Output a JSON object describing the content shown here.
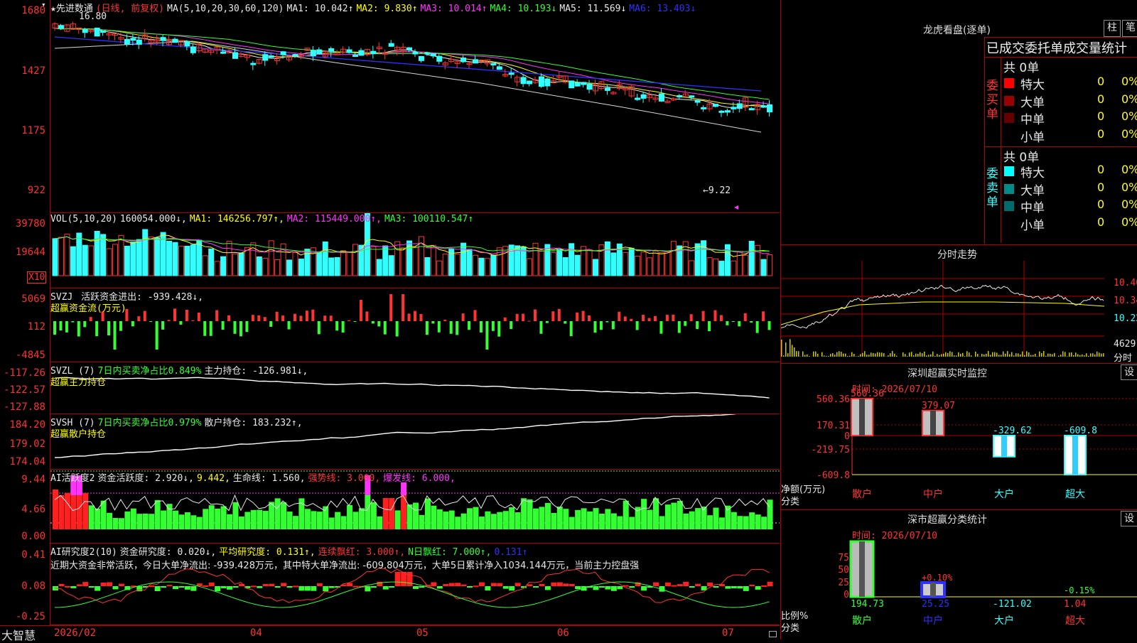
{
  "main": {
    "title": "★先进数通",
    "mode": "(日线, 前复权)",
    "ma_params": "MA(5,10,20,30,60,120)",
    "ma": [
      {
        "label": "MA1: 10.042↑",
        "color": "#e8e8e8"
      },
      {
        "label": "MA2: 9.830↑",
        "color": "#ffff00"
      },
      {
        "label": "MA3: 10.014↑",
        "color": "#ff33ff"
      },
      {
        "label": "MA4: 10.193↓",
        "color": "#33ff33"
      },
      {
        "label": "MA5: 11.569↓",
        "color": "#e8e8e8"
      },
      {
        "label": "MA6: 13.403↓",
        "color": "#3030ff"
      }
    ],
    "y_ticks": [
      "1680",
      "1427",
      "1175",
      "922"
    ],
    "high_label": "16.80",
    "low_label": "←9.22"
  },
  "vol": {
    "header": "VOL(5,10,20)",
    "value": "160054.000↓,",
    "ma1": "MA1: 146256.797↑,",
    "ma2": "MA2: 115449.000↑,",
    "ma3": "MA3: 100110.547↑",
    "y_ticks": [
      "39780",
      "19644"
    ],
    "unit": "X10"
  },
  "svzj": {
    "header": "SVZJ",
    "line1": "活跃资金进出: -939.428↓,",
    "line2": "超赢资金流(万元)",
    "y_ticks": [
      "5069",
      "112",
      "-4845"
    ]
  },
  "svzl": {
    "header": "SVZL (7)",
    "ratio": "7日内买卖净占比0.849%",
    "hold": "主力持仓: -126.981↓,",
    "line2": "超赢主力持仓",
    "y_ticks": [
      "-117.26",
      "-122.57",
      "-127.88"
    ]
  },
  "svsh": {
    "header": "SVSH (7)",
    "ratio": "7日内买卖净占比0.979%",
    "hold": "散户持仓: 183.232↑,",
    "line2": "超赢散户持仓",
    "y_ticks": [
      "184.20",
      "179.02",
      "174.04"
    ]
  },
  "ai1": {
    "header": "AI活跃度2",
    "a": "资金活跃度: 2.920↓,",
    "b": "9.442,",
    "c": "生命线: 1.560,",
    "d": "强势线: 3.000,",
    "e": "爆发线: 6.000,",
    "y_ticks": [
      "9.44",
      "4.66",
      "0.00"
    ]
  },
  "ai2": {
    "header": "AI研究度2(10)",
    "a": "资金研究度: 0.020↓,",
    "b": "平均研究度: 0.131↑,",
    "c": "连续飘红: 3.000↑,",
    "d": "N日飘红: 7.000↑,",
    "e": "0.131↑",
    "summary": "近期大资金非常活跃，今日大单净流出: -939.428万元，其中特大单净流出: -609.804万元，大单5日累计净入1034.144万元，当前主力控盘强",
    "y_ticks": [
      "0.41",
      "0.08",
      "-0.25"
    ]
  },
  "bottom": {
    "brand": "大智慧",
    "dates": [
      "2026/02",
      "04",
      "05",
      "06",
      "07"
    ]
  },
  "right": {
    "lhb_title": "龙虎看盘(逐单)",
    "btn_col": "柱",
    "btn_pen": "笔",
    "stats_title": "已成交委托单成交量统计",
    "buy_label": "委买单",
    "sell_label": "委卖单",
    "buy_total": "共 0单",
    "sell_total": "共 0单",
    "buy_rows": [
      {
        "name": "特大",
        "count": "0",
        "pct": "0%",
        "color": "#ff0000"
      },
      {
        "name": "大单",
        "count": "0",
        "pct": "0%",
        "color": "#990000"
      },
      {
        "name": "中单",
        "count": "0",
        "pct": "0%",
        "color": "#660000"
      },
      {
        "name": "小单",
        "count": "0",
        "pct": "0%",
        "color": ""
      }
    ],
    "sell_rows": [
      {
        "name": "特大",
        "count": "0",
        "pct": "0%",
        "color": "#00ffff"
      },
      {
        "name": "大单",
        "count": "0",
        "pct": "0%",
        "color": "#008b8b"
      },
      {
        "name": "中单",
        "count": "0",
        "pct": "0%",
        "color": "#006b6b"
      },
      {
        "name": "小单",
        "count": "0",
        "pct": "0%",
        "color": ""
      }
    ],
    "intraday_title": "分时走势",
    "intraday_ticks": [
      "10.40",
      "10.34",
      "10.22"
    ],
    "intraday_vol": "4629",
    "intraday_unit": "分时",
    "sz_monitor_title": "深圳超赢实时监控",
    "sz_monitor_btn": "设",
    "sz_monitor_time": "时间: 2026/07/10",
    "net_label": "净额(万元)",
    "cat_label": "分类",
    "sz_class_title": "深市超赢分类统计",
    "sz_class_btn": "设",
    "sz_class_time": "时间: 2026/07/10",
    "ratio_label": "比例%"
  },
  "chart_data": [
    {
      "type": "bar",
      "title": "深圳超赢实时监控",
      "categories": [
        "散户",
        "中户",
        "大户",
        "超大"
      ],
      "values": [
        560.36,
        379.07,
        -329.62,
        -609.8
      ],
      "y_ticks": [
        "560.36",
        "170.31",
        "0",
        "-219.75",
        "-609.8"
      ],
      "ylim": [
        -609.8,
        560.36
      ]
    },
    {
      "type": "bar",
      "title": "深市超赢分类统计",
      "categories": [
        "散户",
        "中户",
        "大户",
        "超大"
      ],
      "values": [
        194.73,
        25.25,
        -121.02,
        1.04
      ],
      "annotations": [
        "+0.10%",
        "-0.15%"
      ],
      "y_ticks": [
        "75",
        "50",
        "25",
        "0"
      ]
    }
  ]
}
